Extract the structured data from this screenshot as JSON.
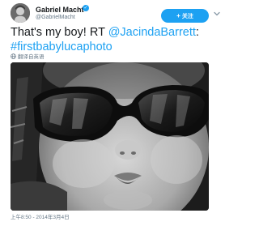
{
  "user": {
    "display_name": "Gabriel Macht",
    "handle": "@GabrielMacht",
    "verified_icon": "verified-badge-icon"
  },
  "follow_button": {
    "label": "关注"
  },
  "tweet": {
    "text_prefix": "That's my boy! RT ",
    "mention": "@JacindaBarrett",
    "text_colon": ":",
    "hashtag": "#firstbabylucaphoto"
  },
  "translate": {
    "label": "翻译自英语",
    "icon": "globe-icon"
  },
  "photo": {
    "description_icon": "photo"
  },
  "meta": {
    "timestamp": "上午8:50 - 2014年3月4日"
  },
  "colors": {
    "accent": "#1da1f2",
    "text": "#14171a",
    "muted": "#657786"
  }
}
